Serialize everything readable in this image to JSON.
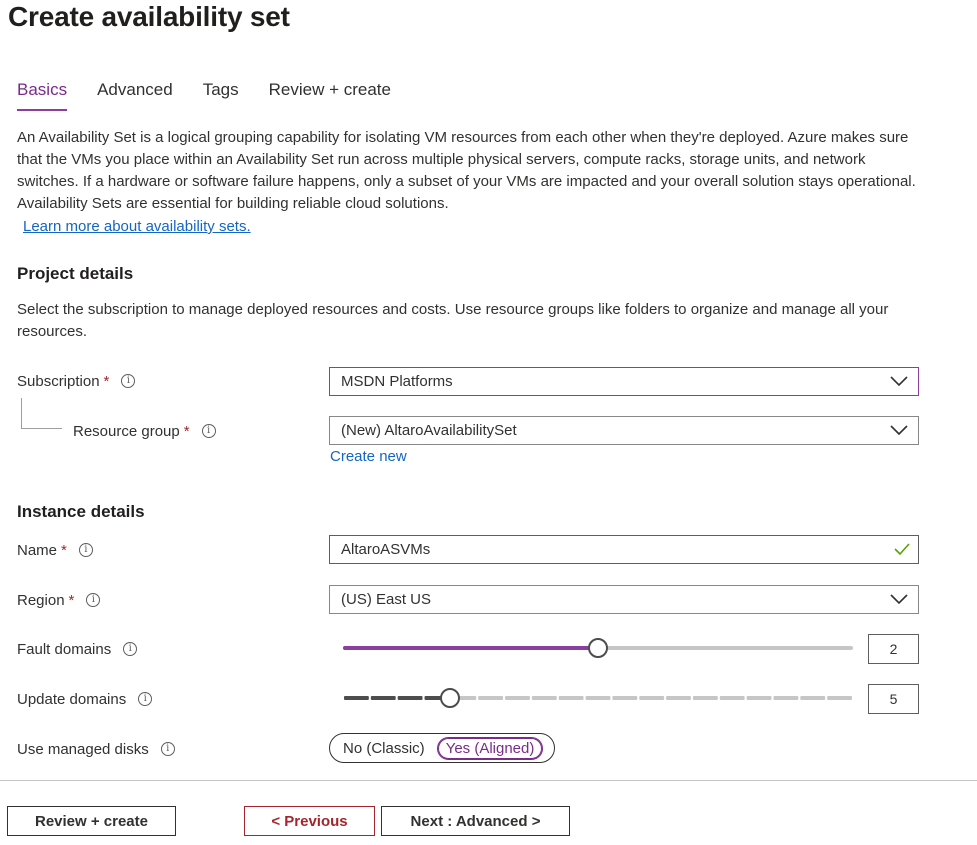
{
  "page": {
    "title": "Create availability set"
  },
  "tabs": [
    {
      "label": "Basics",
      "active": true
    },
    {
      "label": "Advanced",
      "active": false
    },
    {
      "label": "Tags",
      "active": false
    },
    {
      "label": "Review + create",
      "active": false
    }
  ],
  "intro": {
    "text": "An Availability Set is a logical grouping capability for isolating VM resources from each other when they're deployed. Azure makes sure that the VMs you place within an Availability Set run across multiple physical servers, compute racks, storage units, and network switches. If a hardware or software failure happens, only a subset of your VMs are impacted and your overall solution stays operational. Availability Sets are essential for building reliable cloud solutions.",
    "link": "Learn more about availability sets."
  },
  "project": {
    "heading": "Project details",
    "description": "Select the subscription to manage deployed resources and costs. Use resource groups like folders to organize and manage all your resources.",
    "subscription_label": "Subscription",
    "subscription_value": "MSDN Platforms",
    "resource_group_label": "Resource group",
    "resource_group_value": "(New) AltaroAvailabilitySet",
    "create_new": "Create new"
  },
  "instance": {
    "heading": "Instance details",
    "name_label": "Name",
    "name_value": "AltaroASVMs",
    "region_label": "Region",
    "region_value": "(US) East US",
    "fault_label": "Fault domains",
    "fault_value": "2",
    "fault_max": 3,
    "update_label": "Update domains",
    "update_value": "5",
    "update_max": 20,
    "disks_label": "Use managed disks",
    "disks_options": [
      "No (Classic)",
      "Yes (Aligned)"
    ],
    "disks_selected": "Yes (Aligned)"
  },
  "footer": {
    "review_button": "Review + create",
    "previous_button": "< Previous",
    "next_button": "Next : Advanced >"
  },
  "colors": {
    "accent": "#8a3ea0",
    "link": "#1366c4",
    "required": "#a4262c",
    "valid": "#57a300"
  },
  "icons": {
    "info": "info-circle-icon",
    "dropdown": "chevron-down-icon",
    "valid": "checkmark-icon"
  }
}
